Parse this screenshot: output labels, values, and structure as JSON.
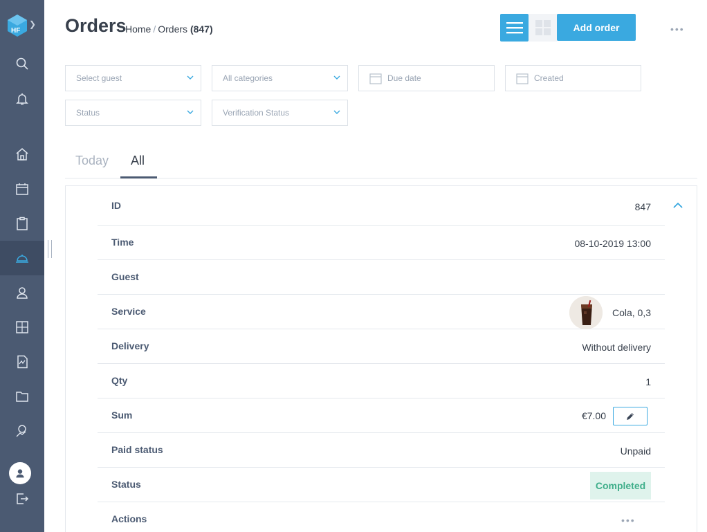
{
  "brand": {
    "logo_text": "HF"
  },
  "header": {
    "title": "Orders",
    "breadcrumb": {
      "home": "Home",
      "separator": "/",
      "current": "Orders",
      "count": "(847)"
    },
    "add_button": "Add order",
    "more": "•••"
  },
  "filters": {
    "guest": "Select guest",
    "categories": "All categories",
    "due_date": "Due date",
    "created": "Created",
    "status": "Status",
    "verification": "Verification Status"
  },
  "tabs": [
    {
      "label": "Today"
    },
    {
      "label": "All"
    }
  ],
  "order": {
    "id": {
      "label": "ID",
      "value": "847"
    },
    "time": {
      "label": "Time",
      "value": "08-10-2019 13:00"
    },
    "guest": {
      "label": "Guest",
      "value": ""
    },
    "service": {
      "label": "Service",
      "value": "Cola, 0,3"
    },
    "delivery": {
      "label": "Delivery",
      "value": "Without delivery"
    },
    "qty": {
      "label": "Qty",
      "value": "1"
    },
    "sum": {
      "label": "Sum",
      "value": "€7.00"
    },
    "paid_status": {
      "label": "Paid status",
      "value": "Unpaid"
    },
    "status": {
      "label": "Status",
      "value": "Completed"
    },
    "actions": {
      "label": "Actions",
      "value": "•••"
    }
  },
  "colors": {
    "sidebar": "#4b5a72",
    "accent": "#3aa9e0",
    "completed_bg": "#dff3ec",
    "completed_text": "#3fae8a"
  },
  "icons": {
    "sidebar": [
      "search-icon",
      "bell-icon",
      "home-icon",
      "calendar-icon",
      "clipboard-icon",
      "cloche-icon",
      "user-icon",
      "calculator-icon",
      "report-icon",
      "folder-icon",
      "money-chart-icon",
      "avatar-icon",
      "logout-icon"
    ]
  }
}
